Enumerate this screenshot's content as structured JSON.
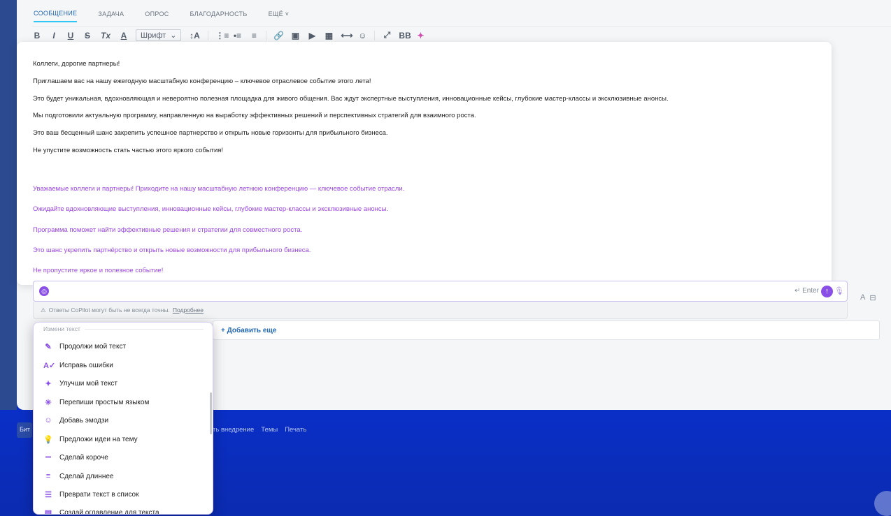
{
  "tabs": [
    {
      "label": "СООБЩЕНИЕ",
      "active": true
    },
    {
      "label": "ЗАДАЧА"
    },
    {
      "label": "ОПРОС"
    },
    {
      "label": "БЛАГОДАРНОСТЬ"
    },
    {
      "label": "ЕЩЁ ˅"
    }
  ],
  "toolbar": {
    "bold": "B",
    "italic": "I",
    "underline": "U",
    "strike": "S",
    "clear_format": "Tx",
    "color": "A",
    "font_select": "Шрифт",
    "font_size": "↕A"
  },
  "message": {
    "original": [
      "Коллеги, дорогие партнеры!",
      "Приглашаем вас на нашу ежегодную масштабную конференцию – ключевое отраслевое событие этого лета!",
      "Это будет уникальная, вдохновляющая и невероятно полезная площадка для живого общения. Вас ждут экспертные выступления, инновационные кейсы, глубокие мастер-классы и эксклюзивные анонсы.",
      "Мы подготовили актуальную программу, направленную на выработку эффективных решений и перспективных стратегий для взаимного роста.",
      "Это ваш бесценный шанс закрепить успешное партнерство и открыть новые горизонты для прибыльного бизнеса.",
      "Не упустите возможность стать частью этого яркого события!"
    ],
    "suggested": [
      "Уважаемые коллеги и партнеры! Приходите на нашу масштабную летнюю конференцию — ключевое событие отрасли.",
      "Ожидайте вдохновляющие выступления, инновационные кейсы, глубокие мастер-классы и эксклюзивные анонсы.",
      "Программа поможет найти эффективные решения и стратегии для совместного роста.",
      "Это шанс укрепить партнёрство и открыть новые возможности для прибыльного бизнеса.",
      "Не пропустите яркое и полезное событие!"
    ]
  },
  "copilot": {
    "enter_hint": "↵ Enter",
    "disclaimer": "Ответы CoPilot могут быть не всегда точны.",
    "more_link": "Подробнее"
  },
  "add_more": "+ Добавить еще",
  "footer": {
    "left": "Бит",
    "links": [
      "ть внедрение",
      "Темы",
      "Печать"
    ]
  },
  "menu": {
    "header": "Измени текст",
    "items": [
      {
        "icon": "pen-icon",
        "glyph": "✎",
        "label": "Продолжи мой текст"
      },
      {
        "icon": "spellcheck-icon",
        "glyph": "A✓",
        "label": "Исправь ошибки"
      },
      {
        "icon": "magic-wand-icon",
        "glyph": "✦",
        "label": "Улучши мой текст"
      },
      {
        "icon": "sparkle-icon",
        "glyph": "✳",
        "label": "Перепиши простым языком"
      },
      {
        "icon": "emoji-icon",
        "glyph": "☺",
        "label": "Добавь эмодзи"
      },
      {
        "icon": "lightbulb-icon",
        "glyph": "💡",
        "label": "Предложи идеи на тему"
      },
      {
        "icon": "shorten-icon",
        "glyph": "═",
        "label": "Сделай короче"
      },
      {
        "icon": "lengthen-icon",
        "glyph": "≡",
        "label": "Сделай длиннее"
      },
      {
        "icon": "list-icon",
        "glyph": "☰",
        "label": "Преврати текст в список"
      },
      {
        "icon": "toc-icon",
        "glyph": "▤",
        "label": "Создай оглавление для текста"
      }
    ]
  },
  "colors": {
    "accent": "#8a4fe6",
    "suggestion_text": "#9a45e0",
    "link": "#2067b0",
    "background": "#1238b8"
  }
}
